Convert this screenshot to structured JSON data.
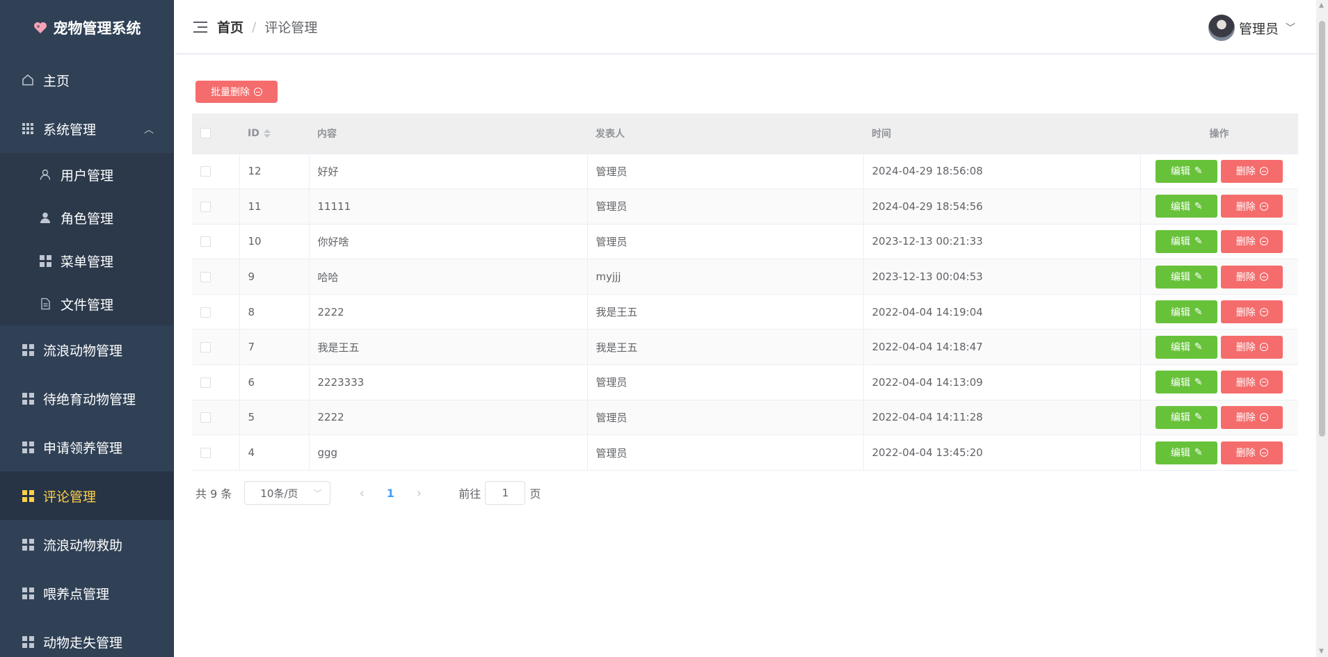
{
  "app": {
    "title": "宠物管理系统"
  },
  "sidebar": {
    "items": [
      {
        "label": "主页",
        "icon": "home-icon"
      },
      {
        "label": "系统管理",
        "icon": "grid-icon",
        "expanded": true,
        "children": [
          {
            "label": "用户管理",
            "icon": "user-icon"
          },
          {
            "label": "角色管理",
            "icon": "user-filled-icon"
          },
          {
            "label": "菜单管理",
            "icon": "menu-grid-icon"
          },
          {
            "label": "文件管理",
            "icon": "document-icon"
          }
        ]
      },
      {
        "label": "流浪动物管理",
        "icon": "menu-grid-icon"
      },
      {
        "label": "待绝育动物管理",
        "icon": "menu-grid-icon"
      },
      {
        "label": "申请领养管理",
        "icon": "menu-grid-icon"
      },
      {
        "label": "评论管理",
        "icon": "menu-grid-icon",
        "active": true
      },
      {
        "label": "流浪动物救助",
        "icon": "menu-grid-icon"
      },
      {
        "label": "喂养点管理",
        "icon": "menu-grid-icon"
      },
      {
        "label": "动物走失管理",
        "icon": "menu-grid-icon"
      }
    ]
  },
  "header": {
    "breadcrumb": {
      "home": "首页",
      "separator": "/",
      "current": "评论管理"
    },
    "user": {
      "name": "管理员"
    }
  },
  "toolbar": {
    "batch_delete_label": "批量删除"
  },
  "table": {
    "columns": {
      "id": "ID",
      "content": "内容",
      "author": "发表人",
      "time": "时间",
      "ops": "操作"
    },
    "edit_label": "编辑",
    "delete_label": "删除",
    "rows": [
      {
        "id": "12",
        "content": "好好",
        "author": "管理员",
        "time": "2024-04-29 18:56:08"
      },
      {
        "id": "11",
        "content": "11111",
        "author": "管理员",
        "time": "2024-04-29 18:54:56"
      },
      {
        "id": "10",
        "content": "你好啥",
        "author": "管理员",
        "time": "2023-12-13 00:21:33"
      },
      {
        "id": "9",
        "content": "哈哈",
        "author": "myjjj",
        "time": "2023-12-13 00:04:53"
      },
      {
        "id": "8",
        "content": "2222",
        "author": "我是王五",
        "time": "2022-04-04 14:19:04"
      },
      {
        "id": "7",
        "content": "我是王五",
        "author": "我是王五",
        "time": "2022-04-04 14:18:47"
      },
      {
        "id": "6",
        "content": "2223333",
        "author": "管理员",
        "time": "2022-04-04 14:13:09"
      },
      {
        "id": "5",
        "content": "2222",
        "author": "管理员",
        "time": "2022-04-04 14:11:28"
      },
      {
        "id": "4",
        "content": "ggg",
        "author": "管理员",
        "time": "2022-04-04 13:45:20"
      }
    ]
  },
  "pagination": {
    "total_text": "共 9 条",
    "page_size": "10条/页",
    "current_page": "1",
    "goto_prefix": "前往",
    "goto_value": "1",
    "goto_suffix": "页"
  },
  "colors": {
    "sidebar_bg": "#304156",
    "active": "#ffd04b",
    "danger": "#f56c6c",
    "success": "#67c23a",
    "primary": "#409eff"
  }
}
